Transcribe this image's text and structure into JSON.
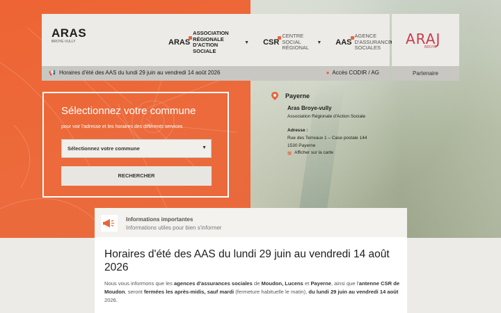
{
  "header": {
    "logo": {
      "text": "ARAS",
      "sub": "BROYE-VULLY"
    },
    "nav": [
      {
        "abbr": "ARAS",
        "label": "Association Régionale d'Action Sociale"
      },
      {
        "abbr": "CSR",
        "label": "Centre Social Régional"
      },
      {
        "abbr": "AAS",
        "label": "Agence d'Assurances Sociales"
      }
    ],
    "partner_logo": {
      "text": "ARAJ",
      "sub": "BROYE"
    },
    "notice": "Horaires d'été des AAS du lundi 29 juin au vendredi 14 août 2026",
    "codir": "Accès CODIR / AG",
    "partner": "Partenaire"
  },
  "commune": {
    "title": "Sélectionnez votre commune",
    "subtitle": "pour voir l'adresse et les horaires des différents services",
    "select_value": "Sélectionnez votre commune",
    "button": "RECHERCHER"
  },
  "location": {
    "city": "Payerne",
    "org": "Aras Broye-vully",
    "org_sub": "Association Régionale d'Action Sociale",
    "address_title": "Adresse :",
    "address_line1": "Rue des Terreaux 1 – Case postale 144",
    "address_line2": "1530 Payerne",
    "map_link": "Afficher sur la carte"
  },
  "info": {
    "heading": "Informations importantes",
    "subheading": "Informations utiles pour bien s'informer",
    "title": "Horaires d'été des AAS du lundi 29 juin au vendredi 14 août 2026",
    "body": {
      "p1": "Nous vous informons que les ",
      "b1": "agences d'assurances sociales",
      "p2": " de ",
      "b2": "Moudon, Lucens",
      "p3": " et ",
      "b3": "Payerne",
      "p4": ", ainsi que l'",
      "b4": "antenne CSR de Moudon",
      "p5": ", seront ",
      "b5": "fermées les après-midis, sauf mardi",
      "p6": " (fermeture habituelle le matin), ",
      "b6": "du lundi 29 juin au vendredi 14 août",
      "p7": " 2026."
    }
  },
  "colors": {
    "accent": "#e9643a",
    "partner": "#c73c4f"
  }
}
